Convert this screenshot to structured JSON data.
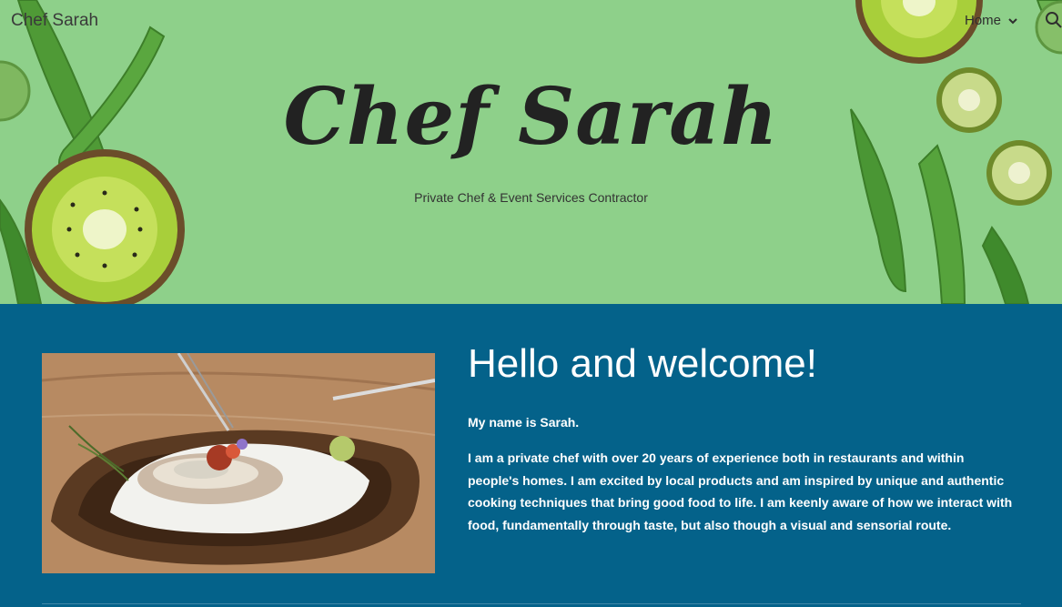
{
  "header": {
    "site_title": "Chef Sarah",
    "nav_home": "Home",
    "search_icon": "search-icon",
    "chevron_icon": "chevron-down-icon"
  },
  "hero": {
    "title": "Chef Sarah",
    "subtitle": "Private Chef & Event Services Contractor",
    "background_color": "#8ed08a"
  },
  "main": {
    "heading": "Hello and welcome!",
    "intro": "My name is Sarah.",
    "bio": "I am a private chef with over 20 years of experience both in restaurants and within people's homes. I am excited by local products and am inspired by unique and authentic cooking techniques that bring good food to life. I am keenly aware of how we interact with food, fundamentally through taste, but also though a visual and sensorial route.",
    "background_color": "#04628a"
  }
}
